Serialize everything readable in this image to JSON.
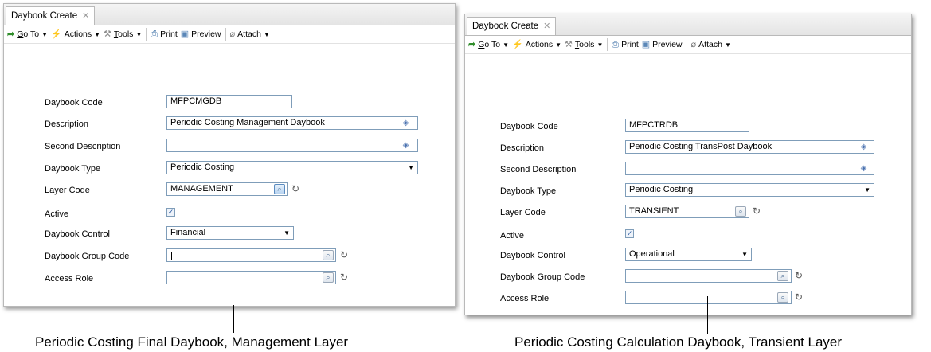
{
  "tab_close": "✕",
  "left": {
    "tab": "Daybook Create",
    "toolbar": {
      "goto": {
        "pre": "",
        "u": "G",
        "post": "o To"
      },
      "actions": {
        "pre": "Actions",
        "u": "",
        "post": ""
      },
      "tools": {
        "pre": "",
        "u": "T",
        "post": "ools"
      },
      "print": "Print",
      "preview": "Preview",
      "attach": "Attach"
    },
    "fields": {
      "daybook_code": {
        "label": "Daybook Code",
        "value": "MFPCMGDB"
      },
      "description": {
        "label": "Description",
        "value": "Periodic Costing Management Daybook"
      },
      "second_description": {
        "label": "Second Description",
        "value": ""
      },
      "daybook_type": {
        "label": "Daybook Type",
        "value": "Periodic Costing"
      },
      "layer_code": {
        "label": "Layer Code",
        "value": "MANAGEMENT"
      },
      "active": {
        "label": "Active",
        "checked": true
      },
      "daybook_control": {
        "label": "Daybook Control",
        "value": "Financial"
      },
      "daybook_group_code": {
        "label": "Daybook Group Code",
        "value": ""
      },
      "access_role": {
        "label": "Access Role",
        "value": ""
      }
    },
    "caption": "Periodic Costing Final Daybook, Management Layer"
  },
  "right": {
    "tab": "Daybook Create",
    "toolbar": {
      "goto": {
        "pre": "",
        "u": "G",
        "post": "o To"
      },
      "actions": {
        "pre": "Actions",
        "u": "",
        "post": ""
      },
      "tools": {
        "pre": "",
        "u": "T",
        "post": "ools"
      },
      "print": "Print",
      "preview": "Preview",
      "attach": "Attach"
    },
    "fields": {
      "daybook_code": {
        "label": "Daybook Code",
        "value": "MFPCTRDB"
      },
      "description": {
        "label": "Description",
        "value": "Periodic Costing TransPost Daybook"
      },
      "second_description": {
        "label": "Second Description",
        "value": ""
      },
      "daybook_type": {
        "label": "Daybook Type",
        "value": "Periodic Costing"
      },
      "layer_code": {
        "label": "Layer Code",
        "value": "TRANSIENT"
      },
      "active": {
        "label": "Active",
        "checked": true
      },
      "daybook_control": {
        "label": "Daybook Control",
        "value": "Operational"
      },
      "daybook_group_code": {
        "label": "Daybook Group Code",
        "value": ""
      },
      "access_role": {
        "label": "Access Role",
        "value": ""
      }
    },
    "caption": "Periodic Costing Calculation Daybook, Transient Layer"
  }
}
